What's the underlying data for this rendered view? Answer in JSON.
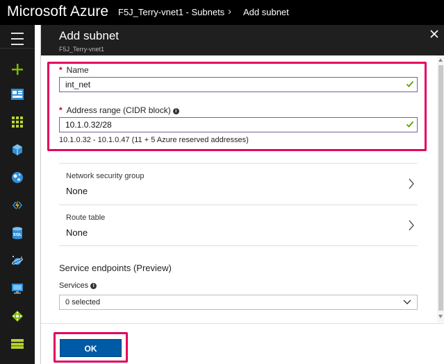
{
  "topbar": {
    "brand": "Microsoft Azure",
    "breadcrumb": [
      "F5J_Terry-vnet1 - Subnets",
      "Add subnet"
    ]
  },
  "leftnav": {
    "items": [
      {
        "name": "hamburger-menu-icon"
      },
      {
        "name": "create-resource-plus-icon",
        "color": "#7fba00"
      },
      {
        "name": "dashboard-icon",
        "color": "#2f8ed6"
      },
      {
        "name": "all-resources-grid-icon",
        "color": "#b8d432"
      },
      {
        "name": "resource-groups-cube-icon",
        "color": "#2f8ed6"
      },
      {
        "name": "app-services-globe-icon",
        "color": "#2f8ed6"
      },
      {
        "name": "function-apps-lightning-icon",
        "color": "#e9a310"
      },
      {
        "name": "sql-databases-icon",
        "color": "#2f8ed6"
      },
      {
        "name": "cosmos-db-planet-icon",
        "color": "#2f8ed6"
      },
      {
        "name": "virtual-machines-monitor-icon",
        "color": "#2f8ed6"
      },
      {
        "name": "load-balancers-icon",
        "color": "#7fba00"
      },
      {
        "name": "storage-accounts-icon",
        "color": "#b8d432"
      }
    ]
  },
  "blade": {
    "title": "Add subnet",
    "subtitle": "F5J_Terry-vnet1"
  },
  "form": {
    "name_label": "Name",
    "name_value": "int_net",
    "range_label": "Address range (CIDR block)",
    "range_value": "10.1.0.32/28",
    "range_hint": "10.1.0.32 - 10.1.0.47 (11 + 5 Azure reserved addresses)",
    "required_marker": "*",
    "info_glyph": "i"
  },
  "rows": {
    "nsg": {
      "title": "Network security group",
      "value": "None"
    },
    "route": {
      "title": "Route table",
      "value": "None"
    }
  },
  "endpoints": {
    "section_title": "Service endpoints (Preview)",
    "services_label": "Services",
    "services_selected": "0 selected"
  },
  "footer": {
    "ok_label": "OK"
  },
  "colors": {
    "highlight": "#e3005f",
    "ok_button": "#005aa6",
    "valid_check": "#57a300"
  }
}
